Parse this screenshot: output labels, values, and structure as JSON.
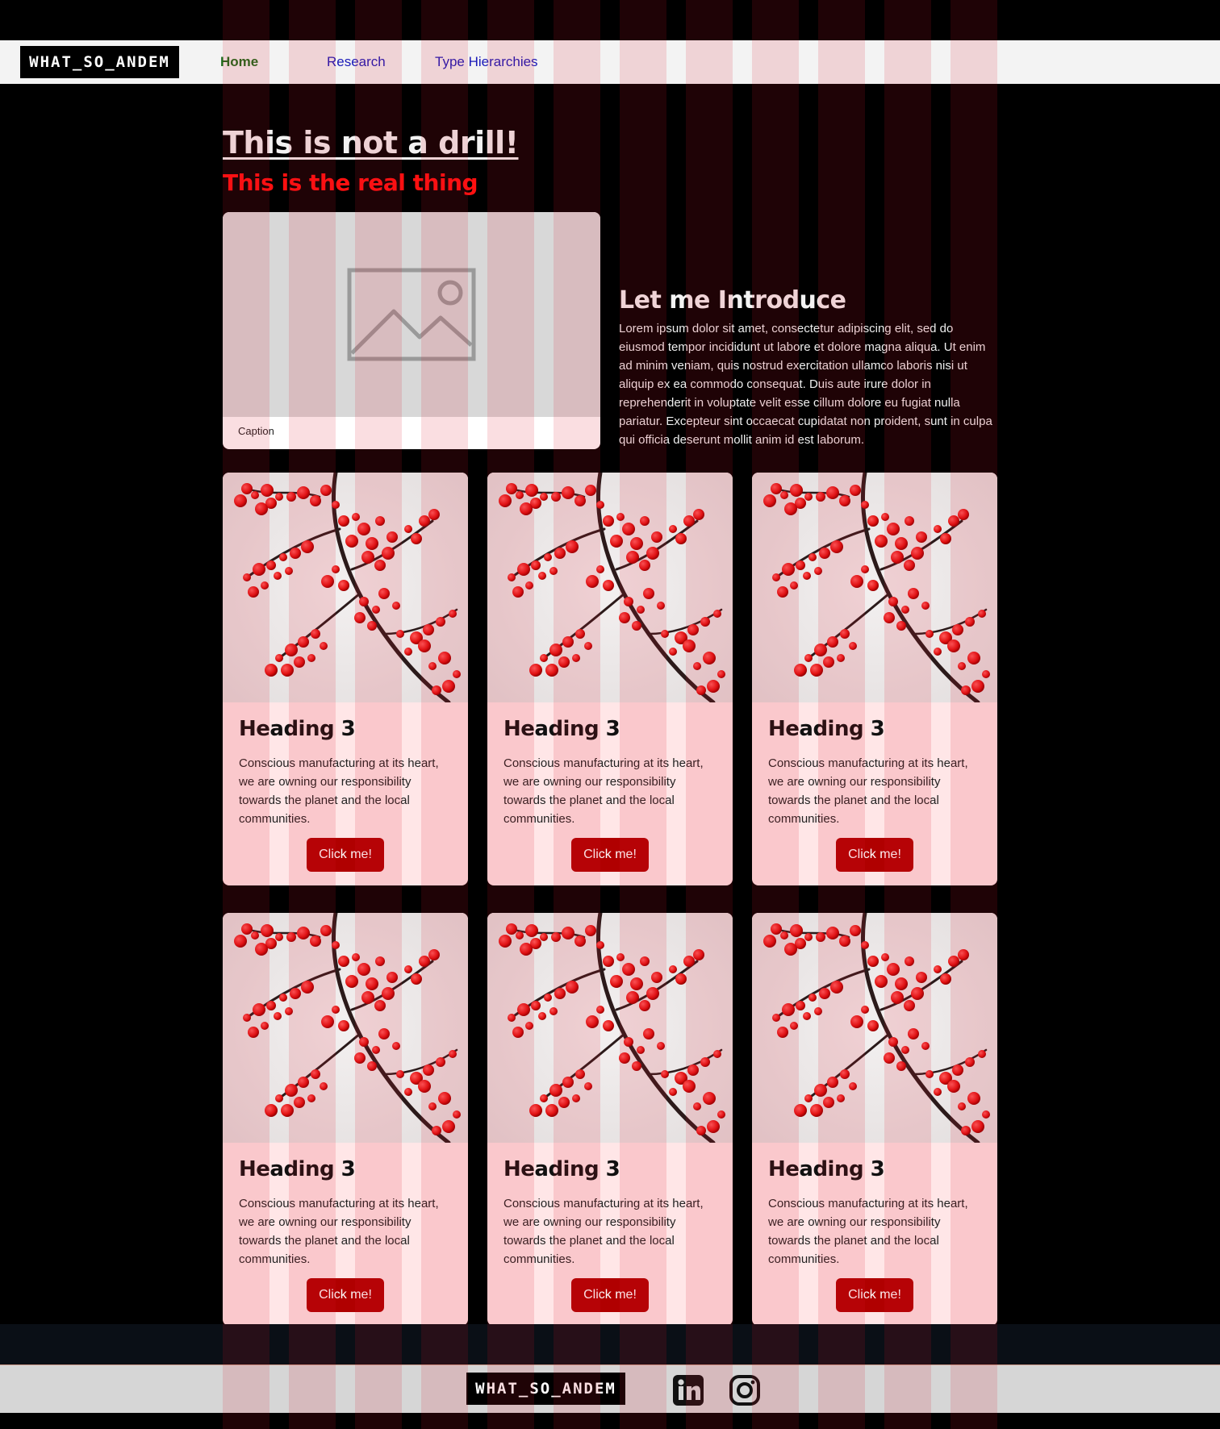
{
  "nav": {
    "logo": "WHAT_SO_ANDEM",
    "links": [
      {
        "label": "Home",
        "active": true
      },
      {
        "label": "Research",
        "active": false
      },
      {
        "label": "Type Hierarchies",
        "active": false
      }
    ]
  },
  "hero": {
    "title": "This is not a drill!",
    "subtitle": "This is the real thing",
    "figure_caption": "Caption",
    "image_icon": "image-placeholder-icon"
  },
  "intro": {
    "title": "Let me Introduce",
    "text": "Lorem ipsum dolor sit amet, consectetur adipiscing elit, sed do eiusmod tempor incididunt ut labore et dolore magna aliqua. Ut enim ad minim veniam, quis nostrud exercitation ullamco laboris nisi ut aliquip ex ea commodo consequat. Duis aute irure dolor in reprehenderit in voluptate velit esse cillum dolore eu fugiat nulla pariatur. Excepteur sint occaecat cupidatat non proident, sunt in culpa qui officia deserunt mollit anim id est laborum."
  },
  "cards": [
    {
      "heading": "Heading 3",
      "text": "Conscious manufacturing at its heart, we are owning our responsibility towards the planet and the local communities.",
      "button": "Click me!"
    },
    {
      "heading": "Heading 3",
      "text": "Conscious manufacturing at its heart, we are owning our responsibility towards the planet and the local communities.",
      "button": "Click me!"
    },
    {
      "heading": "Heading 3",
      "text": "Conscious manufacturing at its heart, we are owning our responsibility towards the planet and the local communities.",
      "button": "Click me!"
    },
    {
      "heading": "Heading 3",
      "text": "Conscious manufacturing at its heart, we are owning our responsibility towards the planet and the local communities.",
      "button": "Click me!"
    },
    {
      "heading": "Heading 3",
      "text": "Conscious manufacturing at its heart, we are owning our responsibility towards the planet and the local communities.",
      "button": "Click me!"
    },
    {
      "heading": "Heading 3",
      "text": "Conscious manufacturing at its heart, we are owning our responsibility towards the planet and the local communities.",
      "button": "Click me!"
    }
  ],
  "footer": {
    "logo": "WHAT_SO_ANDEM",
    "icons": [
      "linkedin-icon",
      "instagram-icon"
    ]
  },
  "colors": {
    "background": "#000000",
    "nav_bg": "#f3f3f3",
    "accent_red": "#ff1010",
    "button_red": "#b00000",
    "card_bg": "#ffe6e7",
    "nav_link": "#1a1ab8",
    "nav_active": "#1b6b1b"
  }
}
